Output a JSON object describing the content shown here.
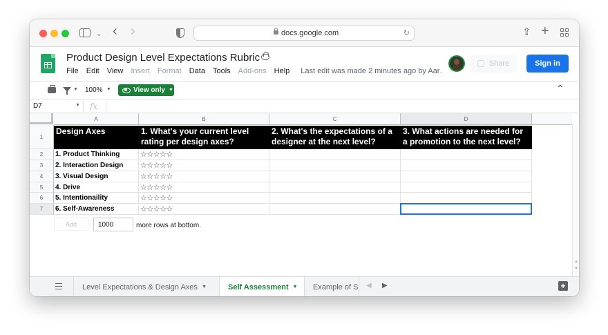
{
  "browser": {
    "url": "docs.google.com"
  },
  "doc": {
    "title": "Product Design Level Expectations Rubric",
    "menu": [
      {
        "label": "File",
        "disabled": false
      },
      {
        "label": "Edit",
        "disabled": false
      },
      {
        "label": "View",
        "disabled": false
      },
      {
        "label": "Insert",
        "disabled": true
      },
      {
        "label": "Format",
        "disabled": true
      },
      {
        "label": "Data",
        "disabled": false
      },
      {
        "label": "Tools",
        "disabled": false
      },
      {
        "label": "Add-ons",
        "disabled": true
      },
      {
        "label": "Help",
        "disabled": false
      }
    ],
    "last_edit": "Last edit was made 2 minutes ago by Aar…",
    "share_label": "Share",
    "sign_in_label": "Sign in"
  },
  "toolbar": {
    "zoom": "100%",
    "view_only_label": "View only"
  },
  "formula_bar": {
    "name_box": "D7",
    "fx": "fx"
  },
  "grid": {
    "columns": [
      "A",
      "B",
      "C",
      "D"
    ],
    "rows": [
      "1",
      "2",
      "3",
      "4",
      "5",
      "6",
      "7"
    ],
    "headers": [
      "Design Axes",
      "1. What's your current level rating per design axes?",
      "2. What's the expectations of a designer at the next level?",
      "3. What actions are needed for a promotion to the next level?"
    ],
    "axes": [
      "1. Product Thinking",
      "2. Interaction Design",
      "3. Visual Design",
      "4. Drive",
      "5. Intentionaility",
      "6. Self-Awareness"
    ],
    "rating": "☆☆☆☆☆",
    "selected_cell": "D7",
    "add_label": "Add",
    "add_rows_value": "1000",
    "more_rows_text": "more rows at bottom."
  },
  "sheets": [
    {
      "label": "Level Expectations & Design Axes",
      "active": false
    },
    {
      "label": "Self Assessment",
      "active": true
    },
    {
      "label": "Example of S",
      "active": false
    }
  ],
  "colors": {
    "sheets_green": "#188038",
    "sign_in_blue": "#1a73e8",
    "header_fill": "#000000",
    "selection": "#1a73e8"
  },
  "icons": [
    "sidebar-icon",
    "back-icon",
    "forward-icon",
    "shield-icon",
    "lock-icon",
    "reload-icon",
    "share-icon",
    "new-tab-icon",
    "tab-overview-icon",
    "sheets-logo-icon",
    "cloud-saved-icon",
    "print-icon",
    "filter-icon",
    "eye-icon",
    "collapse-icon",
    "all-sheets-icon",
    "explore-icon"
  ]
}
